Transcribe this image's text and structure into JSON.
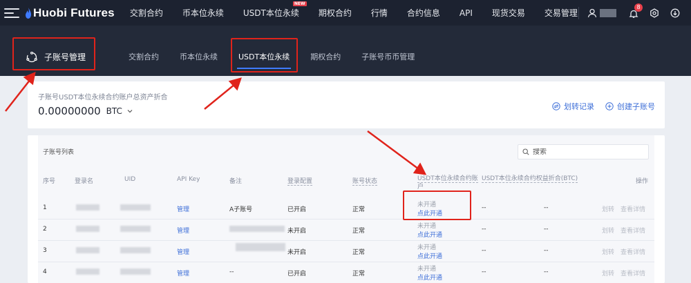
{
  "topnav": {
    "logo": "Huobi Futures",
    "items": [
      {
        "label": "交割合约"
      },
      {
        "label": "币本位永续"
      },
      {
        "label": "USDT本位永续",
        "badge": "NEW"
      },
      {
        "label": "期权合约"
      },
      {
        "label": "行情"
      },
      {
        "label": "合约信息"
      },
      {
        "label": "API"
      },
      {
        "label": "现货交易"
      },
      {
        "label": "交易管理"
      }
    ],
    "notification_count": "8",
    "icons": [
      "menu-icon",
      "user-icon",
      "bell-icon",
      "settings-icon",
      "download-icon"
    ]
  },
  "subheader": {
    "title": "子账号管理",
    "tabs": [
      {
        "label": "交割合约",
        "active": false
      },
      {
        "label": "币本位永续",
        "active": false
      },
      {
        "label": "USDT本位永续",
        "active": true
      },
      {
        "label": "期权合约",
        "active": false
      },
      {
        "label": "子账号币币管理",
        "active": false
      }
    ]
  },
  "asset": {
    "label": "子账号USDT本位永续合约账户总资产折合",
    "value": "0.00000000",
    "unit": "BTC",
    "actions": {
      "transfer_record": "划转记录",
      "create_subaccount": "创建子账号"
    }
  },
  "list": {
    "title": "子账号列表",
    "search_placeholder": "搜索",
    "columns": {
      "index": "序号",
      "login": "登录名",
      "uid": "UID",
      "api_key": "API Key",
      "note": "备注",
      "login_config": "登录配置",
      "account_status": "账号状态",
      "usdt_account": "USDT本位永续合约账户",
      "equity": "USDT本位永续合约权益折合(BTC)",
      "ops": "操作"
    },
    "rows": [
      {
        "index": "1",
        "api": "管理",
        "note": "A子账号",
        "login_config": "已开启",
        "status": "正常",
        "account": "未开通",
        "account_link": "点此开通",
        "equity_a": "--",
        "equity_b": "--",
        "op_transfer": "划转",
        "op_detail": "查看详情"
      },
      {
        "index": "2",
        "api": "管理",
        "note": "",
        "login_config": "未开启",
        "status": "正常",
        "account": "未开通",
        "account_link": "点此开通",
        "equity_a": "--",
        "equity_b": "--",
        "op_transfer": "划转",
        "op_detail": "查看详情"
      },
      {
        "index": "3",
        "api": "管理",
        "note": "",
        "login_config": "未开启",
        "status": "正常",
        "account": "未开通",
        "account_link": "点此开通",
        "equity_a": "--",
        "equity_b": "--",
        "op_transfer": "划转",
        "op_detail": "查看详情"
      },
      {
        "index": "4",
        "api": "管理",
        "note": "--",
        "login_config": "已开启",
        "status": "正常",
        "account": "未开通",
        "account_link": "点此开通",
        "equity_a": "--",
        "equity_b": "--",
        "op_transfer": "划转",
        "op_detail": "查看详情"
      }
    ]
  },
  "colors": {
    "nav_bg": "#1c2230",
    "subheader_bg": "#232a39",
    "accent": "#3e6fd8",
    "annotation": "#e0231b"
  }
}
